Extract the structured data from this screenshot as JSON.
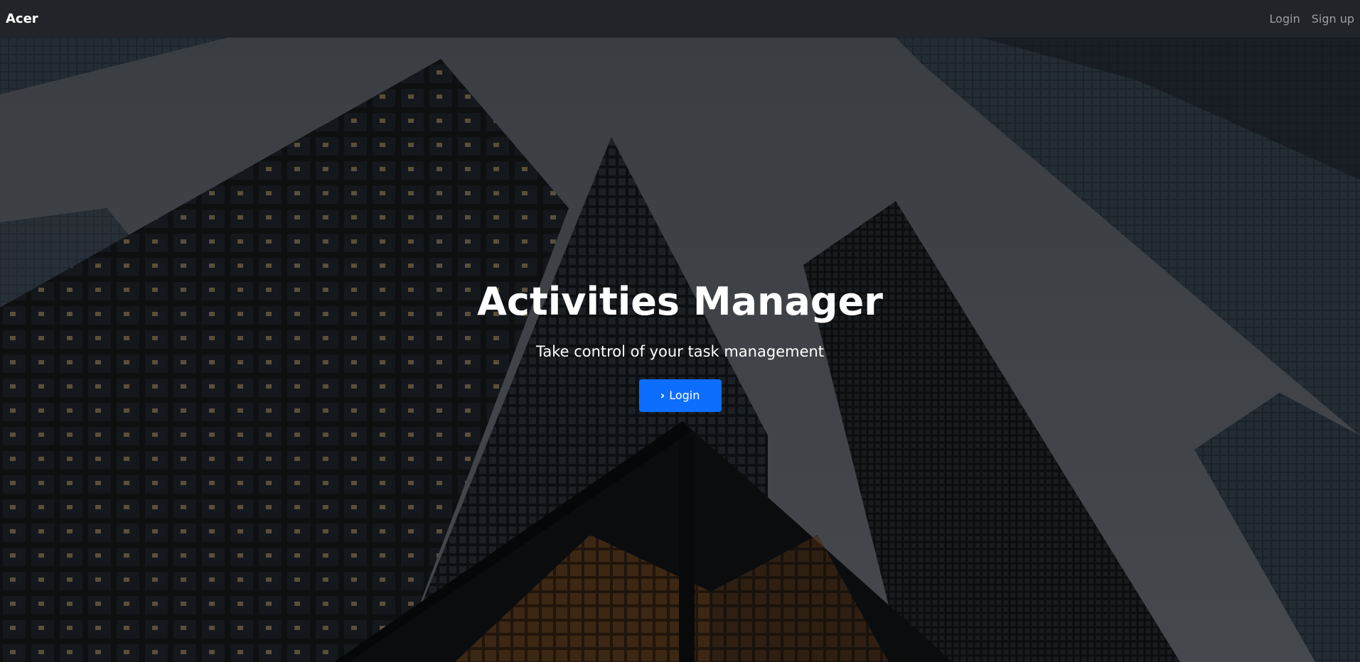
{
  "navbar": {
    "brand": "Acer",
    "links": [
      {
        "label": "Login"
      },
      {
        "label": "Sign up"
      }
    ]
  },
  "hero": {
    "title": "Activities Manager",
    "subtitle": "Take control of your task management",
    "button_label": "Login",
    "button_icon": "chevron-right-icon",
    "background_image": "city-skyscrapers-photo"
  },
  "colors": {
    "navbar_bg": "#212529",
    "primary": "#0d6efd",
    "text_light": "#ffffff",
    "nav_link": "rgba(255,255,255,0.55)"
  }
}
